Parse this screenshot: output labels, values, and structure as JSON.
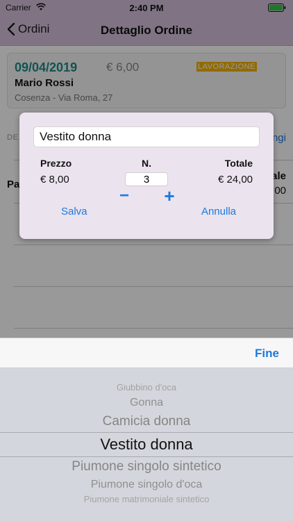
{
  "status_bar": {
    "carrier": "Carrier",
    "time": "2:40 PM"
  },
  "nav": {
    "back_label": "Ordini",
    "title": "Dettaglio Ordine"
  },
  "order": {
    "date": "09/04/2019",
    "price": "€ 6,00",
    "status": "LAVORAZIONE",
    "customer": "Mario Rossi",
    "address": "Cosenza - Via Roma, 27"
  },
  "background": {
    "section_label": "DE",
    "section_action": "ngi",
    "row_label": "Pa",
    "row_right_top": "ale",
    "row_right_bottom": "00"
  },
  "dialog": {
    "item_name": "Vestito donna",
    "price_label": "Prezzo",
    "qty_label": "N.",
    "total_label": "Totale",
    "price_value": "€ 8,00",
    "qty_value": "3",
    "total_value": "€ 24,00",
    "minus": "−",
    "plus": "+",
    "save": "Salva",
    "cancel": "Annulla"
  },
  "picker": {
    "done": "Fine",
    "items": [
      "Giubbino d'oca",
      "Gonna",
      "Camicia donna",
      "Vestito donna",
      "Piumone singolo sintetico",
      "Piumone singolo d'oca",
      "Piumone matrimoniale sintetico"
    ],
    "selected_index": 3
  }
}
